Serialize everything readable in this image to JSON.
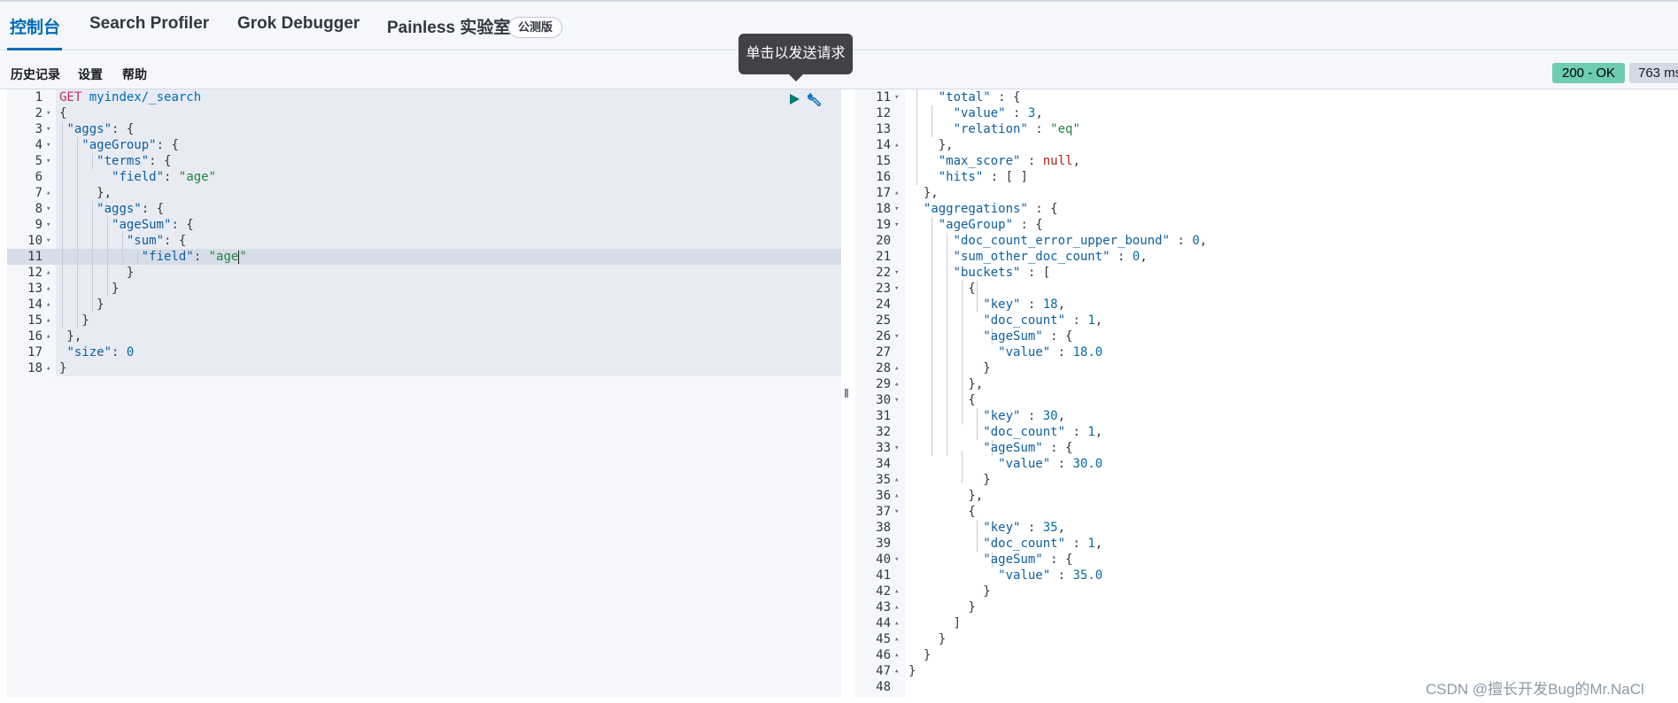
{
  "tabs": [
    {
      "label": "控制台",
      "active": true
    },
    {
      "label": "Search Profiler",
      "active": false
    },
    {
      "label": "Grok Debugger",
      "active": false
    },
    {
      "label": "Painless 实验室",
      "active": false
    }
  ],
  "beta_badge": "公测版",
  "toolbar": {
    "history": "历史记录",
    "settings": "设置",
    "help": "帮助"
  },
  "tooltip": "单击以发送请求",
  "response_status": "200 - OK",
  "response_time": "763 ms",
  "request_lines": [
    {
      "n": "1",
      "fold": ""
    },
    {
      "n": "2",
      "fold": "▾"
    },
    {
      "n": "3",
      "fold": "▾"
    },
    {
      "n": "4",
      "fold": "▾"
    },
    {
      "n": "5",
      "fold": "▾"
    },
    {
      "n": "6",
      "fold": ""
    },
    {
      "n": "7",
      "fold": "▴"
    },
    {
      "n": "8",
      "fold": "▾"
    },
    {
      "n": "9",
      "fold": "▾"
    },
    {
      "n": "10",
      "fold": "▾"
    },
    {
      "n": "11",
      "fold": ""
    },
    {
      "n": "12",
      "fold": "▴"
    },
    {
      "n": "13",
      "fold": "▴"
    },
    {
      "n": "14",
      "fold": "▴"
    },
    {
      "n": "15",
      "fold": "▴"
    },
    {
      "n": "16",
      "fold": "▴"
    },
    {
      "n": "17",
      "fold": ""
    },
    {
      "n": "18",
      "fold": "▴"
    }
  ],
  "request_code": [
    [
      [
        "tok-method",
        "GET"
      ],
      [
        "tok-punc",
        " "
      ],
      [
        "tok-url",
        "myindex/_search"
      ]
    ],
    [
      [
        "tok-punc",
        "{"
      ]
    ],
    [
      [
        "tok-punc",
        " "
      ],
      [
        "tok-key",
        "\"aggs\""
      ],
      [
        "tok-punc",
        ": {"
      ]
    ],
    [
      [
        "tok-punc",
        "   "
      ],
      [
        "tok-key",
        "\"ageGroup\""
      ],
      [
        "tok-punc",
        ": {"
      ]
    ],
    [
      [
        "tok-punc",
        "     "
      ],
      [
        "tok-key",
        "\"terms\""
      ],
      [
        "tok-punc",
        ": {"
      ]
    ],
    [
      [
        "tok-punc",
        "       "
      ],
      [
        "tok-key",
        "\"field\""
      ],
      [
        "tok-punc",
        ": "
      ],
      [
        "tok-str",
        "\"age\""
      ]
    ],
    [
      [
        "tok-punc",
        "     },"
      ]
    ],
    [
      [
        "tok-punc",
        "     "
      ],
      [
        "tok-key",
        "\"aggs\""
      ],
      [
        "tok-punc",
        ": {"
      ]
    ],
    [
      [
        "tok-punc",
        "       "
      ],
      [
        "tok-key",
        "\"ageSum\""
      ],
      [
        "tok-punc",
        ": {"
      ]
    ],
    [
      [
        "tok-punc",
        "         "
      ],
      [
        "tok-key",
        "\"sum\""
      ],
      [
        "tok-punc",
        ": {"
      ]
    ],
    [
      [
        "tok-punc",
        "           "
      ],
      [
        "tok-key",
        "\"field\""
      ],
      [
        "tok-punc",
        ": "
      ],
      [
        "tok-str",
        "\"age"
      ],
      [
        "cursor",
        ""
      ],
      [
        "tok-str",
        "\""
      ]
    ],
    [
      [
        "tok-punc",
        "         }"
      ]
    ],
    [
      [
        "tok-punc",
        "       }"
      ]
    ],
    [
      [
        "tok-punc",
        "     }"
      ]
    ],
    [
      [
        "tok-punc",
        "   }"
      ]
    ],
    [
      [
        "tok-punc",
        " },"
      ]
    ],
    [
      [
        "tok-punc",
        " "
      ],
      [
        "tok-key",
        "\"size\""
      ],
      [
        "tok-punc",
        ": "
      ],
      [
        "tok-num",
        "0"
      ]
    ],
    [
      [
        "tok-punc",
        "}"
      ]
    ]
  ],
  "response_lines": [
    {
      "n": "11",
      "fold": "▾"
    },
    {
      "n": "12",
      "fold": ""
    },
    {
      "n": "13",
      "fold": ""
    },
    {
      "n": "14",
      "fold": "▴"
    },
    {
      "n": "15",
      "fold": ""
    },
    {
      "n": "16",
      "fold": ""
    },
    {
      "n": "17",
      "fold": "▴"
    },
    {
      "n": "18",
      "fold": "▾"
    },
    {
      "n": "19",
      "fold": "▾"
    },
    {
      "n": "20",
      "fold": ""
    },
    {
      "n": "21",
      "fold": ""
    },
    {
      "n": "22",
      "fold": "▾"
    },
    {
      "n": "23",
      "fold": "▾"
    },
    {
      "n": "24",
      "fold": ""
    },
    {
      "n": "25",
      "fold": ""
    },
    {
      "n": "26",
      "fold": "▾"
    },
    {
      "n": "27",
      "fold": ""
    },
    {
      "n": "28",
      "fold": "▴"
    },
    {
      "n": "29",
      "fold": "▴"
    },
    {
      "n": "30",
      "fold": "▾"
    },
    {
      "n": "31",
      "fold": ""
    },
    {
      "n": "32",
      "fold": ""
    },
    {
      "n": "33",
      "fold": "▾"
    },
    {
      "n": "34",
      "fold": ""
    },
    {
      "n": "35",
      "fold": "▴"
    },
    {
      "n": "36",
      "fold": "▴"
    },
    {
      "n": "37",
      "fold": "▾"
    },
    {
      "n": "38",
      "fold": ""
    },
    {
      "n": "39",
      "fold": ""
    },
    {
      "n": "40",
      "fold": "▾"
    },
    {
      "n": "41",
      "fold": ""
    },
    {
      "n": "42",
      "fold": "▴"
    },
    {
      "n": "43",
      "fold": "▴"
    },
    {
      "n": "44",
      "fold": "▴"
    },
    {
      "n": "45",
      "fold": "▴"
    },
    {
      "n": "46",
      "fold": "▴"
    },
    {
      "n": "47",
      "fold": "▴"
    },
    {
      "n": "48",
      "fold": ""
    }
  ],
  "response_code": [
    [
      [
        "tok-punc",
        "    "
      ],
      [
        "tok-key",
        "\"total\""
      ],
      [
        "tok-punc",
        " : {"
      ]
    ],
    [
      [
        "tok-punc",
        "      "
      ],
      [
        "tok-key",
        "\"value\""
      ],
      [
        "tok-punc",
        " : "
      ],
      [
        "tok-num",
        "3"
      ],
      [
        "tok-punc",
        ","
      ]
    ],
    [
      [
        "tok-punc",
        "      "
      ],
      [
        "tok-key",
        "\"relation\""
      ],
      [
        "tok-punc",
        " : "
      ],
      [
        "tok-str",
        "\"eq\""
      ]
    ],
    [
      [
        "tok-punc",
        "    },"
      ]
    ],
    [
      [
        "tok-punc",
        "    "
      ],
      [
        "tok-key",
        "\"max_score\""
      ],
      [
        "tok-punc",
        " : "
      ],
      [
        "tok-null",
        "null"
      ],
      [
        "tok-punc",
        ","
      ]
    ],
    [
      [
        "tok-punc",
        "    "
      ],
      [
        "tok-key",
        "\"hits\""
      ],
      [
        "tok-punc",
        " : [ ]"
      ]
    ],
    [
      [
        "tok-punc",
        "  },"
      ]
    ],
    [
      [
        "tok-punc",
        "  "
      ],
      [
        "tok-key",
        "\"aggregations\""
      ],
      [
        "tok-punc",
        " : {"
      ]
    ],
    [
      [
        "tok-punc",
        "    "
      ],
      [
        "tok-key",
        "\"ageGroup\""
      ],
      [
        "tok-punc",
        " : {"
      ]
    ],
    [
      [
        "tok-punc",
        "      "
      ],
      [
        "tok-key",
        "\"doc_count_error_upper_bound\""
      ],
      [
        "tok-punc",
        " : "
      ],
      [
        "tok-num",
        "0"
      ],
      [
        "tok-punc",
        ","
      ]
    ],
    [
      [
        "tok-punc",
        "      "
      ],
      [
        "tok-key",
        "\"sum_other_doc_count\""
      ],
      [
        "tok-punc",
        " : "
      ],
      [
        "tok-num",
        "0"
      ],
      [
        "tok-punc",
        ","
      ]
    ],
    [
      [
        "tok-punc",
        "      "
      ],
      [
        "tok-key",
        "\"buckets\""
      ],
      [
        "tok-punc",
        " : ["
      ]
    ],
    [
      [
        "tok-punc",
        "        {"
      ]
    ],
    [
      [
        "tok-punc",
        "          "
      ],
      [
        "tok-key",
        "\"key\""
      ],
      [
        "tok-punc",
        " : "
      ],
      [
        "tok-num",
        "18"
      ],
      [
        "tok-punc",
        ","
      ]
    ],
    [
      [
        "tok-punc",
        "          "
      ],
      [
        "tok-key",
        "\"doc_count\""
      ],
      [
        "tok-punc",
        " : "
      ],
      [
        "tok-num",
        "1"
      ],
      [
        "tok-punc",
        ","
      ]
    ],
    [
      [
        "tok-punc",
        "          "
      ],
      [
        "tok-key",
        "\"ageSum\""
      ],
      [
        "tok-punc",
        " : {"
      ]
    ],
    [
      [
        "tok-punc",
        "            "
      ],
      [
        "tok-key",
        "\"value\""
      ],
      [
        "tok-punc",
        " : "
      ],
      [
        "tok-num",
        "18.0"
      ]
    ],
    [
      [
        "tok-punc",
        "          }"
      ]
    ],
    [
      [
        "tok-punc",
        "        },"
      ]
    ],
    [
      [
        "tok-punc",
        "        {"
      ]
    ],
    [
      [
        "tok-punc",
        "          "
      ],
      [
        "tok-key",
        "\"key\""
      ],
      [
        "tok-punc",
        " : "
      ],
      [
        "tok-num",
        "30"
      ],
      [
        "tok-punc",
        ","
      ]
    ],
    [
      [
        "tok-punc",
        "          "
      ],
      [
        "tok-key",
        "\"doc_count\""
      ],
      [
        "tok-punc",
        " : "
      ],
      [
        "tok-num",
        "1"
      ],
      [
        "tok-punc",
        ","
      ]
    ],
    [
      [
        "tok-punc",
        "          "
      ],
      [
        "tok-key",
        "\"ageSum\""
      ],
      [
        "tok-punc",
        " : {"
      ]
    ],
    [
      [
        "tok-punc",
        "            "
      ],
      [
        "tok-key",
        "\"value\""
      ],
      [
        "tok-punc",
        " : "
      ],
      [
        "tok-num",
        "30.0"
      ]
    ],
    [
      [
        "tok-punc",
        "          }"
      ]
    ],
    [
      [
        "tok-punc",
        "        },"
      ]
    ],
    [
      [
        "tok-punc",
        "        {"
      ]
    ],
    [
      [
        "tok-punc",
        "          "
      ],
      [
        "tok-key",
        "\"key\""
      ],
      [
        "tok-punc",
        " : "
      ],
      [
        "tok-num",
        "35"
      ],
      [
        "tok-punc",
        ","
      ]
    ],
    [
      [
        "tok-punc",
        "          "
      ],
      [
        "tok-key",
        "\"doc_count\""
      ],
      [
        "tok-punc",
        " : "
      ],
      [
        "tok-num",
        "1"
      ],
      [
        "tok-punc",
        ","
      ]
    ],
    [
      [
        "tok-punc",
        "          "
      ],
      [
        "tok-key",
        "\"ageSum\""
      ],
      [
        "tok-punc",
        " : {"
      ]
    ],
    [
      [
        "tok-punc",
        "            "
      ],
      [
        "tok-key",
        "\"value\""
      ],
      [
        "tok-punc",
        " : "
      ],
      [
        "tok-num",
        "35.0"
      ]
    ],
    [
      [
        "tok-punc",
        "          }"
      ]
    ],
    [
      [
        "tok-punc",
        "        }"
      ]
    ],
    [
      [
        "tok-punc",
        "      ]"
      ]
    ],
    [
      [
        "tok-punc",
        "    }"
      ]
    ],
    [
      [
        "tok-punc",
        "  }"
      ]
    ],
    [
      [
        "tok-punc",
        "}"
      ]
    ],
    [
      [
        "tok-punc",
        ""
      ]
    ]
  ],
  "watermark": "CSDN @擅长开发Bug的Mr.NaCl",
  "colors": {
    "accent": "#006bb8",
    "status_ok": "#6dccb1",
    "method": "#c72a5c",
    "string": "#20823f"
  },
  "icons": [
    "play-icon",
    "wrench-icon",
    "resize-handle-icon"
  ]
}
